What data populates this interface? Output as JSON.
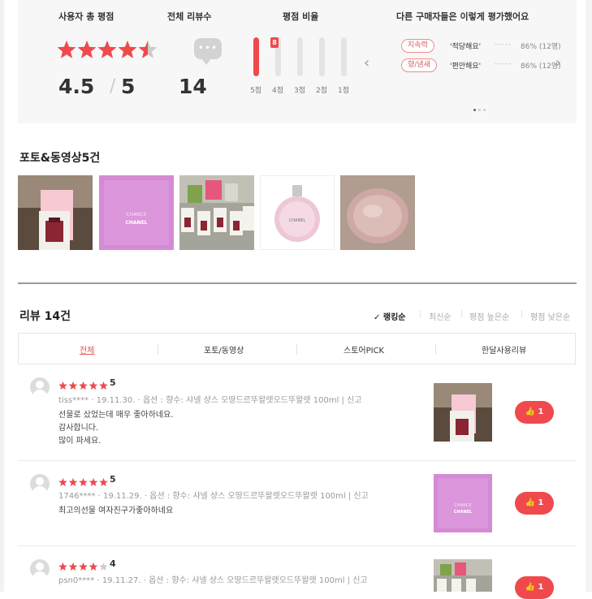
{
  "summary": {
    "avg_title": "사용자 총 평점",
    "avg_score": "4.5",
    "avg_max": "5",
    "avg_rating_value": 4.5,
    "count_title": "전체 리뷰수",
    "count": "14",
    "ratio_title": "평점 비율",
    "ratio_badge": "8",
    "ratio_bars": [
      {
        "label": "5점",
        "fraction": 1.0
      },
      {
        "label": "4점",
        "fraction": 0
      },
      {
        "label": "3점",
        "fraction": 0
      },
      {
        "label": "2점",
        "fraction": 0
      },
      {
        "label": "1점",
        "fraction": 0
      }
    ],
    "others_title": "다른 구매자들은 이렇게 평가했어요",
    "others": [
      {
        "chip": "지속력",
        "answer": "'적당해요'",
        "dashes": "-----",
        "pct": "86% (12명)"
      },
      {
        "chip": "향/냄새",
        "answer": "'편안해요'",
        "dashes": "-----",
        "pct": "86% (12명)"
      }
    ],
    "prev_arrow": "‹",
    "next_arrow": "›"
  },
  "photos": {
    "title": "포토&동영상5건",
    "chanel_text": "CHANEL",
    "chance_text": "CHANCE"
  },
  "reviews_header": {
    "title": "리뷰 14건",
    "check": "✓",
    "sort_options": [
      "랭킹순",
      "최신순",
      "평점 높은순",
      "평점 낮은순"
    ],
    "sort_sep": "|",
    "tabs": [
      "전체",
      "포토/동영상",
      "스토어PICK",
      "한달사용리뷰"
    ]
  },
  "reviews": [
    {
      "rating": 5,
      "score": "5",
      "user": "tiss****",
      "date": "19.11.30.",
      "option": "옵션 : 향수: 샤넬 샹스 오땅드르뚜왈렛오드뚜왈렛 100ml",
      "report": "신고",
      "body": [
        "선물로 샀었는데 매우 좋아하네요.",
        "감사합니다.",
        "많이 파세요."
      ],
      "likes": "1"
    },
    {
      "rating": 5,
      "score": "5",
      "user": "1746****",
      "date": "19.11.29.",
      "option": "옵션 : 향수: 샤넬 샹스 오땅드르뚜왈렛오드뚜왈렛 100ml",
      "report": "신고",
      "body": [
        "최고의선물 여자친구가좋아하네요"
      ],
      "likes": "1"
    },
    {
      "rating": 4,
      "score": "4",
      "user": "psn0****",
      "date": "19.11.27.",
      "option": "옵션 : 향수: 샤넬 샹스 오땅드르뚜왈렛오드뚜왈렛 100ml",
      "report": "신고",
      "body": [],
      "likes": "1"
    }
  ],
  "colors": {
    "accent": "#f0494d",
    "star_empty": "#cccccc",
    "chip_border": "#f08a8c",
    "panel_bg": "#f7f7f7"
  },
  "icons": [
    "star-icon",
    "speech-bubble-icon",
    "chevron-left-icon",
    "chevron-right-icon",
    "checkmark-icon",
    "thumbs-up-icon",
    "avatar-icon"
  ]
}
